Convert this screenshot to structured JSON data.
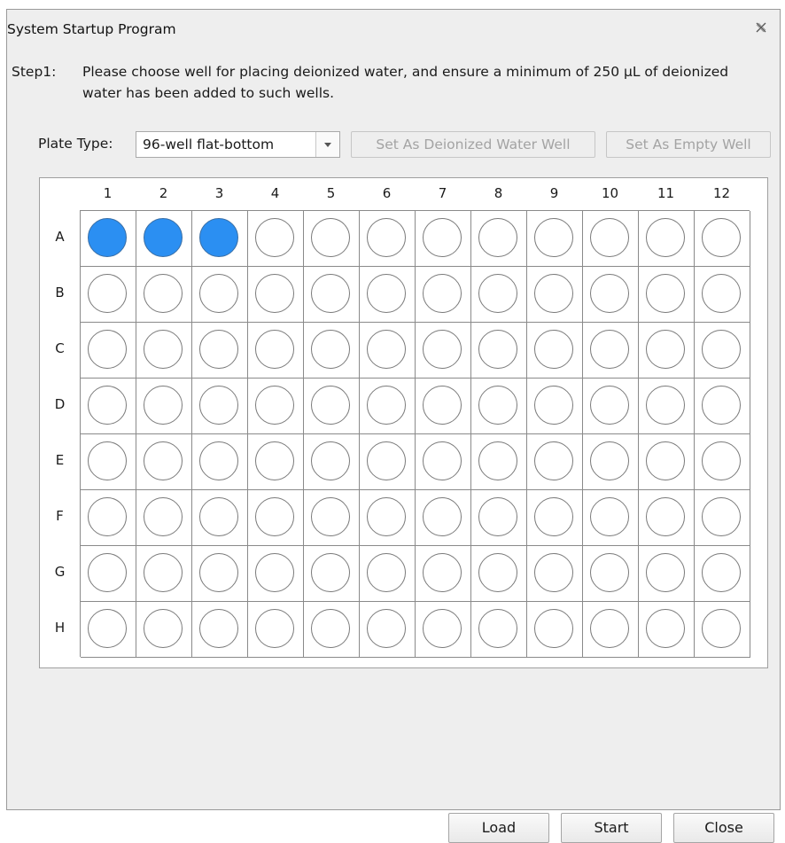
{
  "dialog": {
    "title": "System Startup Program",
    "close_icon": "close-icon"
  },
  "step": {
    "label": "Step1:",
    "text": "Please choose well for placing deionized water, and ensure a minimum of 250 µL of deionized water has been added to such wells."
  },
  "plate": {
    "type_label": "Plate Type:",
    "type_value": "96-well flat-bottom",
    "set_water_label": "Set As Deionized Water Well",
    "set_empty_label": "Set As Empty Well",
    "columns": [
      "1",
      "2",
      "3",
      "4",
      "5",
      "6",
      "7",
      "8",
      "9",
      "10",
      "11",
      "12"
    ],
    "rows": [
      "A",
      "B",
      "C",
      "D",
      "E",
      "F",
      "G",
      "H"
    ],
    "filled_wells": [
      "A1",
      "A2",
      "A3"
    ],
    "filled_color": "#2b8ff2"
  },
  "footer": {
    "load_label": "Load",
    "start_label": "Start",
    "close_label": "Close"
  }
}
